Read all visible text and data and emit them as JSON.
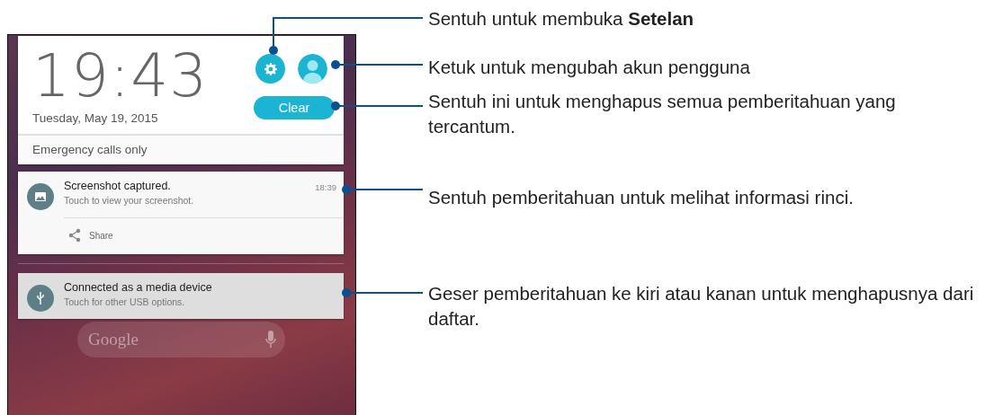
{
  "phone": {
    "clock": "19:43",
    "date": "Tuesday, May 19, 2015",
    "clear_button": "Clear",
    "status": "Emergency calls only",
    "notifications": [
      {
        "title": "Screenshot captured.",
        "text": "Touch to view your screenshot.",
        "time": "18:39",
        "action": "Share",
        "highlighted": false
      },
      {
        "title": "Connected as a media device",
        "text": "Touch for other USB options.",
        "highlighted": true
      }
    ],
    "search_bar": "Google"
  },
  "callouts": [
    {
      "text": "Sentuh untuk membuka **Setelan**"
    },
    {
      "text": "Ketuk untuk mengubah akun pengguna"
    },
    {
      "text": "Sentuh ini untuk menghapus semua pemberitahuan yang tercantum."
    },
    {
      "text": "Sentuh pemberitahuan untuk melihat informasi rinci."
    },
    {
      "text": "Geser pemberitahuan ke kiri atau kanan untuk menghapusnya dari daftar."
    }
  ]
}
